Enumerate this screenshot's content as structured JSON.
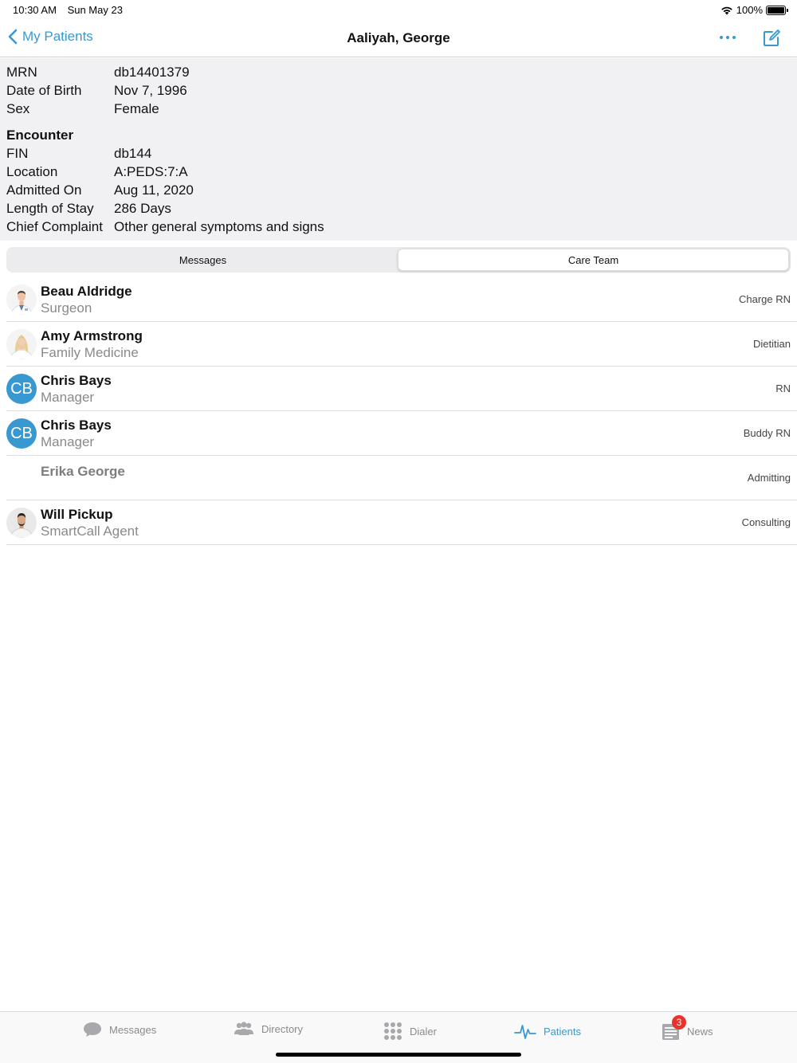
{
  "status_bar": {
    "time": "10:30 AM",
    "date": "Sun May 23",
    "battery": "100%"
  },
  "nav": {
    "back_label": "My Patients",
    "title": "Aaliyah, George"
  },
  "patient": {
    "fields": [
      {
        "label": "MRN",
        "value": "db14401379"
      },
      {
        "label": "Date of Birth",
        "value": "Nov 7, 1996"
      },
      {
        "label": "Sex",
        "value": "Female"
      }
    ],
    "encounter_heading": "Encounter",
    "encounter": [
      {
        "label": "FIN",
        "value": "db144"
      },
      {
        "label": "Location",
        "value": "A:PEDS:7:A"
      },
      {
        "label": "Admitted On",
        "value": "Aug 11, 2020"
      },
      {
        "label": "Length of Stay",
        "value": "286 Days"
      },
      {
        "label": "Chief Complaint",
        "value": "Other general symptoms and signs"
      }
    ]
  },
  "segments": {
    "messages": "Messages",
    "care_team": "Care Team",
    "selected": "Care Team"
  },
  "care_team": [
    {
      "name": "Beau Aldridge",
      "title": "Surgeon",
      "role": "Charge RN",
      "avatar": "photo"
    },
    {
      "name": "Amy Armstrong",
      "title": "Family Medicine",
      "role": "Dietitian",
      "avatar": "photo"
    },
    {
      "name": "Chris Bays",
      "title": "Manager",
      "role": "RN",
      "avatar": "initials",
      "initials": "CB"
    },
    {
      "name": "Chris Bays",
      "title": "Manager",
      "role": "Buddy RN",
      "avatar": "initials",
      "initials": "CB"
    },
    {
      "name": "Erika George",
      "title": "",
      "role": "Admitting",
      "avatar": "none"
    },
    {
      "name": "Will Pickup",
      "title": "SmartCall Agent",
      "role": "Consulting",
      "avatar": "photo"
    }
  ],
  "tab_bar": {
    "messages": "Messages",
    "directory": "Directory",
    "dialer": "Dialer",
    "patients": "Patients",
    "news": "News",
    "news_badge": "3",
    "active": "Patients"
  },
  "colors": {
    "accent": "#3a98d1",
    "badge": "#e8322b",
    "panel_bg": "#f1f1f3"
  }
}
